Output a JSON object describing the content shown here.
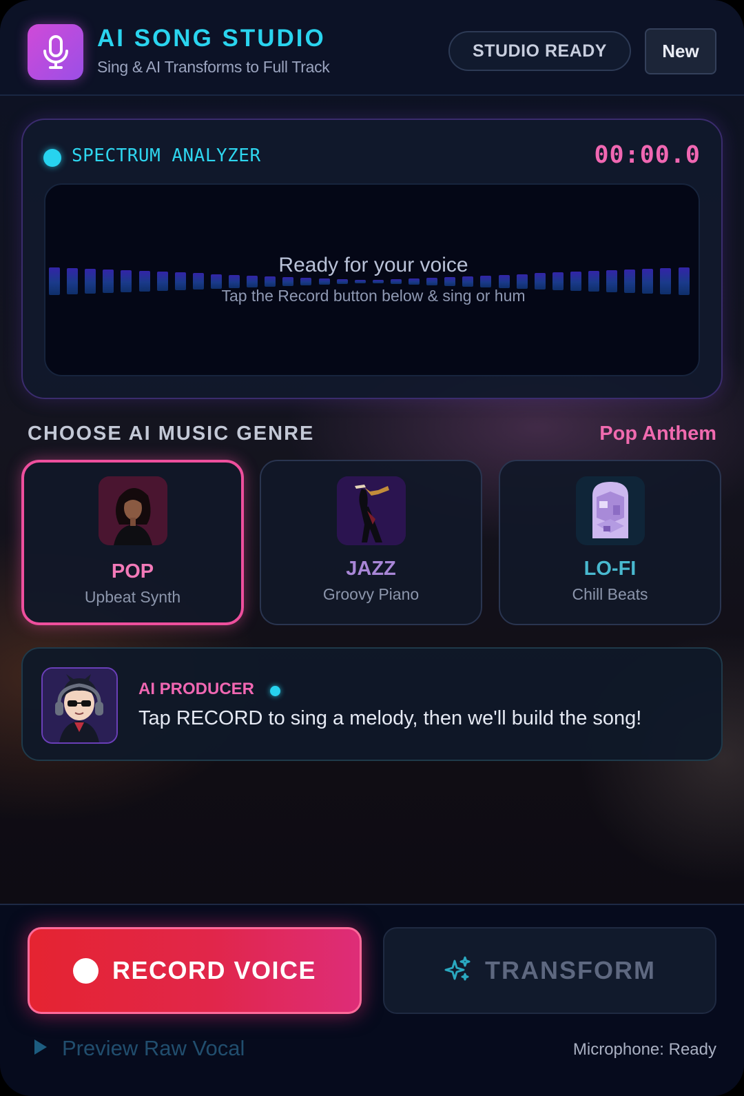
{
  "header": {
    "title": "AI SONG STUDIO",
    "subtitle": "Sing & AI Transforms to Full Track",
    "status": "STUDIO READY",
    "new_label": "New"
  },
  "spectrum": {
    "title": "SPECTRUM ANALYZER",
    "timer": "00:00.0",
    "message": "Ready for your voice",
    "hint": "Tap the Record button below & sing or hum"
  },
  "genres": {
    "heading": "CHOOSE AI MUSIC GENRE",
    "selected": "Pop Anthem",
    "items": [
      {
        "name": "POP",
        "desc": "Upbeat Synth",
        "color": "#f27ab8"
      },
      {
        "name": "JAZZ",
        "desc": "Groovy Piano",
        "color": "#a886d6"
      },
      {
        "name": "LO-FI",
        "desc": "Chill Beats",
        "color": "#49b9cf"
      }
    ]
  },
  "producer": {
    "label": "AI PRODUCER",
    "message": "Tap RECORD to sing a melody, then we'll build the song!"
  },
  "controls": {
    "record_label": "RECORD VOICE",
    "transform_label": "TRANSFORM",
    "preview_label": "Preview Raw Vocal",
    "mic_status": "Microphone: Ready"
  },
  "colors": {
    "accent_cyan": "#2ad4ef",
    "accent_pink": "#f067b2",
    "record_red": "#e52431"
  }
}
